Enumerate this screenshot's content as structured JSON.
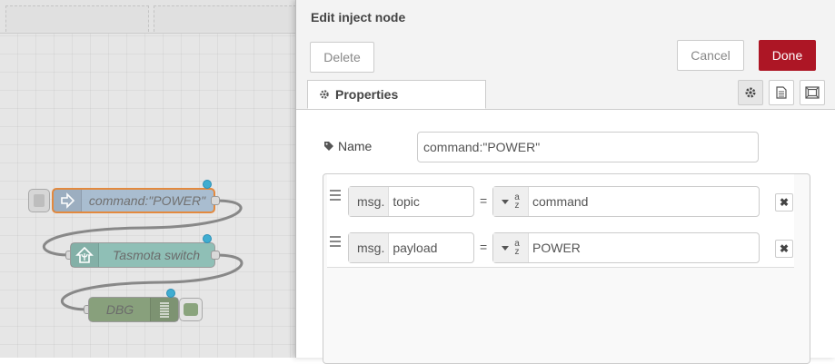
{
  "workspace": {
    "nodes": [
      {
        "id": "inject",
        "label": "command:\"POWER\"",
        "icon": "inject-arrow-icon",
        "color": "#a6bbcf"
      },
      {
        "id": "tasmota",
        "label": "Tasmota switch",
        "icon": "tasmota-switch-icon",
        "color": "#8fbfb6"
      },
      {
        "id": "dbg",
        "label": "DBG",
        "icon": "debug-list-icon",
        "color": "#88a07c"
      }
    ],
    "selected_border_color": "#e38536",
    "changed_indicator_color": "#3fadd1"
  },
  "tray": {
    "title": "Edit inject node",
    "buttons": {
      "delete": "Delete",
      "cancel": "Cancel",
      "done": "Done"
    },
    "done_color": "#ad1625",
    "tabs": [
      {
        "label": "Properties",
        "icon": "gear-icon",
        "active": true
      }
    ],
    "icon_tabs": [
      "settings-gear-icon",
      "description-doc-icon",
      "appearance-frame-icon"
    ],
    "name_label": "Name",
    "name_value": "command:\"POWER\"",
    "properties": [
      {
        "prefix": "msg.",
        "property": "topic",
        "equals": "=",
        "type_icon": "string-az-icon",
        "value": "command"
      },
      {
        "prefix": "msg.",
        "property": "payload",
        "equals": "=",
        "type_icon": "string-az-icon",
        "value": "POWER"
      }
    ]
  }
}
